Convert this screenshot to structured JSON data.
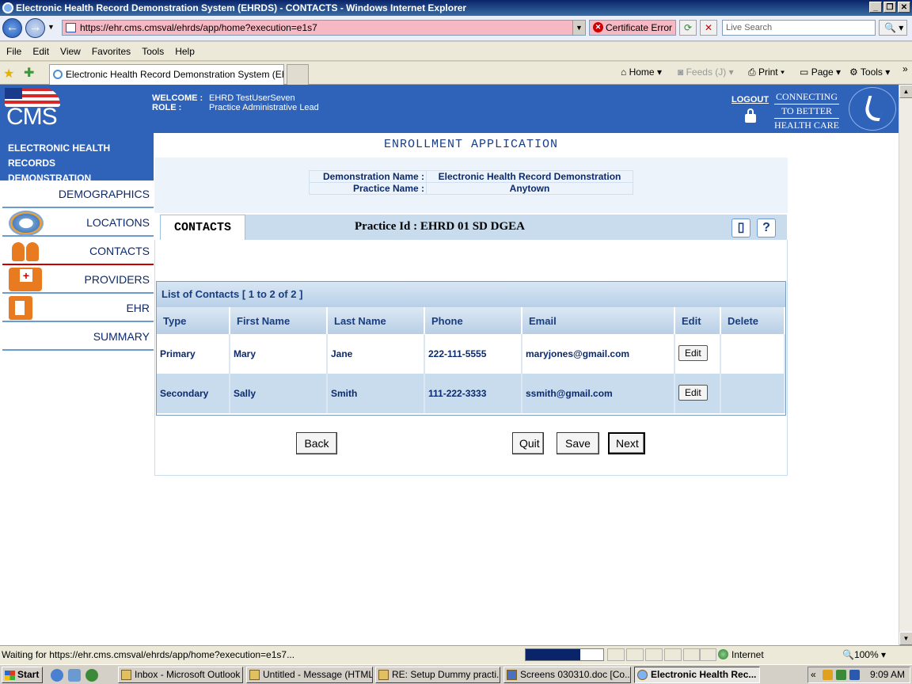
{
  "window": {
    "title": "Electronic Health Record Demonstration System (EHRDS) - CONTACTS - Windows Internet Explorer",
    "buttons": [
      "_",
      "❐",
      "✕"
    ]
  },
  "browser": {
    "url": "https://ehr.cms.cmsval/ehrds/app/home?execution=e1s7",
    "cert_error": "Certificate Error",
    "search_placeholder": "Live Search",
    "menu": [
      "File",
      "Edit",
      "View",
      "Favorites",
      "Tools",
      "Help"
    ],
    "tab_title": "Electronic Health Record Demonstration System (EHR...",
    "commands": {
      "home": "Home",
      "feeds": "Feeds (J)",
      "print": "Print",
      "page": "Page",
      "tools": "Tools"
    }
  },
  "header": {
    "logo_text": "CMS",
    "welcome_label": "WELCOME :",
    "welcome_value": "EHRD TestUserSeven",
    "role_label": "ROLE :",
    "role_value": "Practice Administrative Lead",
    "logout": "LOGOUT",
    "tagline": [
      "CONNECTING",
      "TO BETTER",
      "HEALTH CARE"
    ]
  },
  "sidebar": {
    "title_line1": "ELECTRONIC HEALTH RECORDS",
    "title_line2": "DEMONSTRATION",
    "items": [
      {
        "label": "DEMOGRAPHICS"
      },
      {
        "label": "LOCATIONS"
      },
      {
        "label": "CONTACTS"
      },
      {
        "label": "PROVIDERS"
      },
      {
        "label": "EHR"
      },
      {
        "label": "SUMMARY"
      }
    ],
    "active": "CONTACTS"
  },
  "main": {
    "title": "ENROLLMENT APPLICATION",
    "demo_name_label": "Demonstration Name :",
    "demo_name_value": "Electronic Health Record Demonstration",
    "practice_name_label": "Practice Name :",
    "practice_name_value": "Anytown",
    "section_tab": "CONTACTS",
    "practice_id": "Practice Id : EHRD 01 SD DGEA",
    "list_title": "List of Contacts [ 1 to 2 of 2 ]",
    "columns": [
      "Type",
      "First Name",
      "Last Name",
      "Phone",
      "Email",
      "Edit",
      "Delete"
    ],
    "rows": [
      {
        "type": "Primary",
        "first": "Mary",
        "last": "Jane",
        "phone": "222-111-5555",
        "email": "maryjones@gmail.com",
        "edit": "Edit"
      },
      {
        "type": "Secondary",
        "first": "Sally",
        "last": "Smith",
        "phone": "111-222-3333",
        "email": "ssmith@gmail.com",
        "edit": "Edit"
      }
    ],
    "buttons": {
      "back": "Back",
      "quit": "Quit",
      "save": "Save",
      "next": "Next"
    }
  },
  "status": {
    "text": "Waiting for https://ehr.cms.cmsval/ehrds/app/home?execution=e1s7...",
    "progress": 0.7,
    "zone": "Internet",
    "zoom": "100%"
  },
  "taskbar": {
    "start": "Start",
    "tasks": [
      "Inbox - Microsoft Outlook",
      "Untitled - Message (HTML)",
      "RE: Setup Dummy practi...",
      "Screens 030310.doc [Co...",
      "Electronic Health Rec..."
    ],
    "tray_arrow": "«",
    "clock": "9:09 AM"
  },
  "colors": {
    "header_blue": "#2f63ba",
    "text_navy": "#0b2a6e",
    "row_alt": "#c8dcee",
    "address_error_pink": "#f6b8c2"
  }
}
